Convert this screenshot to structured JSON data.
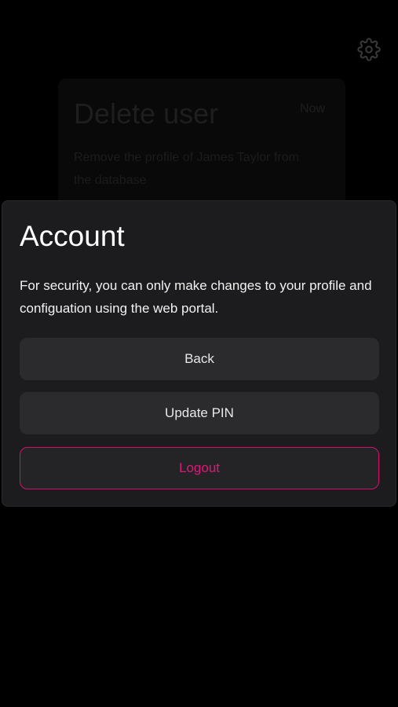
{
  "background": {
    "settings_icon": "gear-icon",
    "card": {
      "title": "Delete user",
      "time": "Now",
      "description": "Remove the profile of James Taylor from the database"
    }
  },
  "sheet": {
    "title": "Account",
    "message": "For security, you can only make changes to your profile and configuation using the web portal.",
    "buttons": {
      "back": "Back",
      "update_pin": "Update PIN",
      "logout": "Logout"
    }
  },
  "colors": {
    "background": "#000000",
    "sheet": "#1c1c1e",
    "button": "#2b2b2d",
    "accent": "#e0177a"
  }
}
